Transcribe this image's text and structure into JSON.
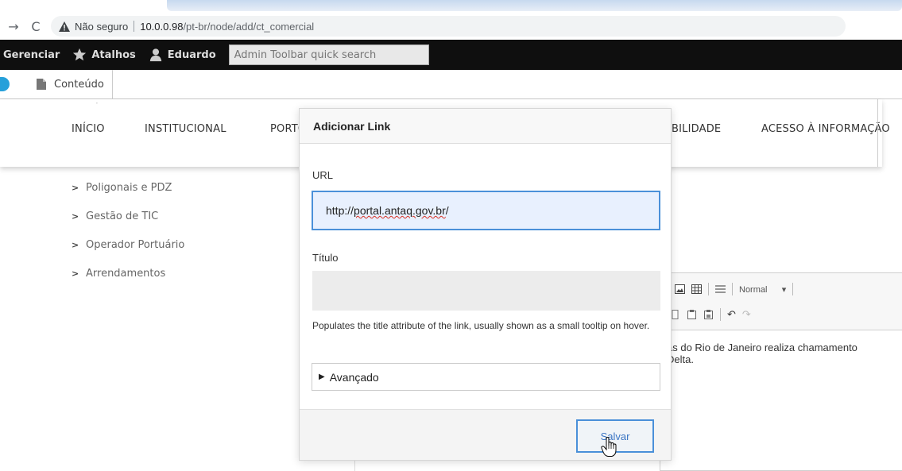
{
  "browser": {
    "security_label": "Não seguro",
    "url_host": "10.0.0.98",
    "url_path": "/pt-br/node/add/ct_comercial"
  },
  "admin_toolbar": {
    "manage_label": "Gerenciar",
    "shortcuts_label": "Atalhos",
    "user_label": "Eduardo",
    "search_placeholder": "Admin Toolbar quick search"
  },
  "tray": {
    "content_label": "Conteúdo"
  },
  "site_nav": {
    "items": [
      "INÍCIO",
      "INSTITUCIONAL",
      "PORTO",
      "BILIDADE",
      "ACESSO À INFORMAÇÃO"
    ]
  },
  "left_menu": {
    "items": [
      "Poligonais e PDZ",
      "Gestão de TIC",
      "Operador Portuário",
      "Arrendamentos"
    ]
  },
  "editor": {
    "format_label": "Normal",
    "body_text": "as do Rio de Janeiro realiza chamamento\nDelta."
  },
  "dialog": {
    "title": "Adicionar Link",
    "url_label": "URL",
    "url_prefix": "http://",
    "url_domain": "portal.antaq.gov.br",
    "url_suffix": "/",
    "title_label": "Título",
    "title_value": "",
    "title_help": "Populates the title attribute of the link, usually shown as a small tooltip on hover.",
    "advanced_label": "Avançado",
    "save_label": "Salvar"
  },
  "colors": {
    "toolbar_bg": "#0f0f0f",
    "focus_border": "#4a90d9",
    "url_field_bg": "#e8f0fe"
  }
}
